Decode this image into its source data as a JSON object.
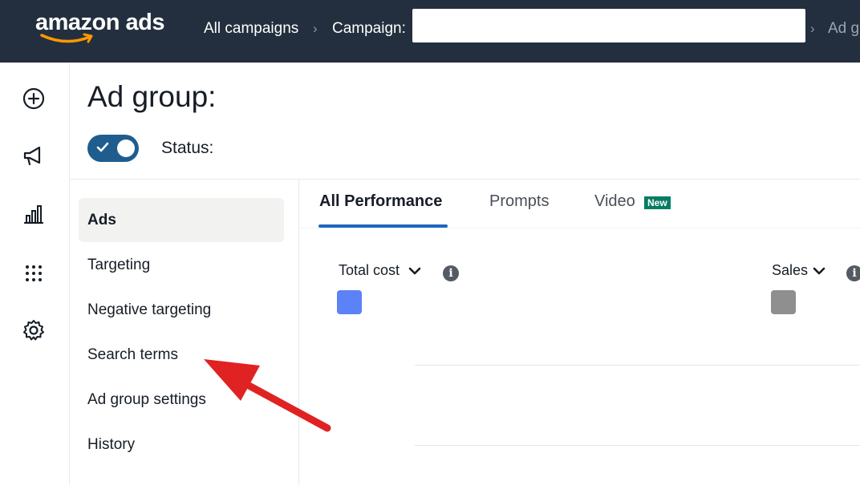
{
  "header": {
    "logo_text": "amazon ads",
    "breadcrumbs": {
      "all_campaigns": "All campaigns",
      "campaign_label": "Campaign:",
      "campaign_value": "",
      "ad_group_partial": "Ad g"
    }
  },
  "rail": {
    "icons": [
      "add-circle-icon",
      "megaphone-icon",
      "bar-chart-icon",
      "apps-grid-icon",
      "gear-icon"
    ]
  },
  "page": {
    "title": "Ad group:",
    "status_label": "Status:",
    "status_enabled": true
  },
  "subnav": {
    "items": [
      {
        "label": "Ads",
        "active": true
      },
      {
        "label": "Targeting",
        "active": false
      },
      {
        "label": "Negative targeting",
        "active": false
      },
      {
        "label": "Search terms",
        "active": false
      },
      {
        "label": "Ad group settings",
        "active": false
      },
      {
        "label": "History",
        "active": false
      }
    ]
  },
  "tabs": {
    "items": [
      {
        "label": "All Performance",
        "active": true
      },
      {
        "label": "Prompts",
        "active": false
      },
      {
        "label": "Video",
        "active": false,
        "badge": "New"
      }
    ]
  },
  "metrics": [
    {
      "label": "Total cost",
      "color": "#5b82f7"
    },
    {
      "label": "Sales",
      "color": "#8f8f8f"
    }
  ],
  "colors": {
    "header_bg": "#232f3e",
    "toggle_on": "#1f5d8f",
    "tab_accent": "#1f66c0",
    "badge_bg": "#067d62",
    "annotation_arrow": "#e02222"
  }
}
